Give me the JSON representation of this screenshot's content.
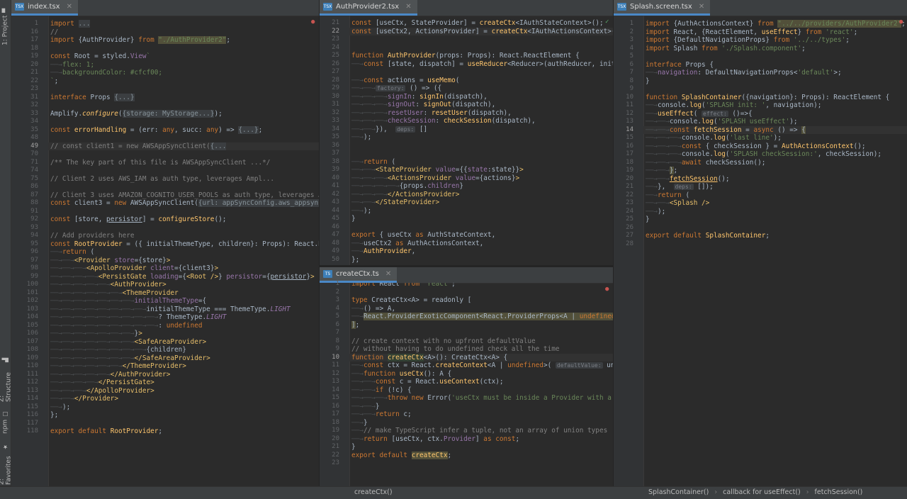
{
  "sidebar": {
    "project": "1: Project",
    "structure": "Z: Structure",
    "npm": "npm",
    "favorites": "2: Favorites"
  },
  "icons": {
    "file": "tsx-file-icon",
    "close": "close-icon",
    "fold": "fold-marker-icon",
    "error": "error-marker-icon",
    "ok": "check-icon"
  },
  "colors": {
    "keyword": "#cc7832",
    "string": "#6a8759",
    "function": "#ffc66d",
    "field": "#9876aa",
    "comment": "#808080",
    "tab_accent": "#4a88c7"
  },
  "editors": [
    {
      "tab": "index.tsx",
      "lines": [
        {
          "n": "1",
          "t": "<span class='kw'>import</span> <span class='col'>...</span>"
        },
        {
          "n": "16",
          "t": "<span class='cm'>//</span>"
        },
        {
          "n": "17",
          "t": "<span class='kw'>import</span> {AuthProvider} <span class='kw'>from</span> <span class='str hl2'>\"./AuthProvider2\"</span>;"
        },
        {
          "n": "18",
          "t": ""
        },
        {
          "n": "19",
          "t": "<span class='kw'>const</span> Root = styled.<span class='fld'>View</span><span class='str'>`</span>"
        },
        {
          "n": "20",
          "t": "<span class='tab-i'>──→</span><span class='str'>flex: 1;</span>"
        },
        {
          "n": "21",
          "t": "<span class='tab-i'>──→</span><span class='str'>backgroundColor: #cfcf00;</span>"
        },
        {
          "n": "22",
          "t": "<span class='str'>`</span>;"
        },
        {
          "n": "23",
          "t": ""
        },
        {
          "n": "31",
          "t": "<span class='kw'>interface</span> Props <span class='col'>{...}</span>"
        },
        {
          "n": "32",
          "t": ""
        },
        {
          "n": "33",
          "t": "Amplify.<span class='fn' style='font-style:italic'>configure</span>(<span class='col'>{storage: MyStorage...}</span>);"
        },
        {
          "n": "34",
          "t": ""
        },
        {
          "n": "35",
          "t": "<span class='kw'>const</span> <span class='fn'>errorHandling</span> = (err: <span class='kw'>any</span>, succ: <span class='kw'>any</span>) => <span class='col'>{...}</span>;"
        },
        {
          "n": "48",
          "t": ""
        },
        {
          "n": "49",
          "t": "<span class='cm'>// const client1 = new AWSAppSyncClient(</span><span class='col'>{...</span>",
          "cl": true
        },
        {
          "n": "70",
          "t": ""
        },
        {
          "n": "71",
          "t": "<span class='cm'>/** The key part of this file is AWSAppSyncClient ...*/</span>"
        },
        {
          "n": "74",
          "t": ""
        },
        {
          "n": "75",
          "t": "<span class='cm'>// Client 2 uses AWS_IAM as auth type, leverages Ampl...</span>"
        },
        {
          "n": "86",
          "t": ""
        },
        {
          "n": "87",
          "t": "<span class='cm'>// Client 3 uses AMAZON_COGNITO_USER_POOLS as auth type, leverages Ampli</span>"
        },
        {
          "n": "88",
          "t": "<span class='kw'>const</span> client3 = <span class='kw'>new</span> AWSAppSyncClient(<span class='col'>{url: appSyncConfig.aws_appsync_gra</span>"
        },
        {
          "n": "91",
          "t": ""
        },
        {
          "n": "92",
          "t": "<span class='kw'>const</span> [store, <span class='ul'>persistor</span>] = <span class='fn'>configureStore</span>();"
        },
        {
          "n": "93",
          "t": ""
        },
        {
          "n": "94",
          "t": "<span class='cm'>// Add providers here</span>"
        },
        {
          "n": "95",
          "t": "<span class='kw'>const</span> <span class='fn'>RootProvider</span> = ({ initialThemeType, children}: Props): React.React"
        },
        {
          "n": "96",
          "t": "<span class='tab-i'>──→</span><span class='kw'>return</span> ("
        },
        {
          "n": "97",
          "t": "<span class='tab-i'>──→──→</span><span class='tag'>&lt;Provider</span> <span class='fld'>store</span>={store}<span class='tag'>&gt;</span>"
        },
        {
          "n": "98",
          "t": "<span class='tab-i'>──→──→──→</span><span class='tag'>&lt;ApolloProvider</span> <span class='fld'>client</span>={client3}<span class='tag'>&gt;</span>"
        },
        {
          "n": "99",
          "t": "<span class='tab-i'>──→──→──→──→</span><span class='tag'>&lt;PersistGate</span> <span class='fld'>loading</span>={<span class='tag'>&lt;Root /&gt;</span>} <span class='fld'>persistor</span>={<span class='ul'>persistor</span>}<span class='tag'>&gt;</span>"
        },
        {
          "n": "100",
          "t": "<span class='tab-i'>──→──→──→──→──→</span><span class='tag'>&lt;AuthProvider&gt;</span>"
        },
        {
          "n": "101",
          "t": "<span class='tab-i'>──→──→──→──→──→──→</span><span class='tag'>&lt;ThemeProvider</span>"
        },
        {
          "n": "102",
          "t": "<span class='tab-i'>──→──→──→──→──→──→──→</span><span class='fld'>initialThemeType</span>={"
        },
        {
          "n": "103",
          "t": "<span class='tab-i'>──→──→──→──→──→──→──→──→</span>initialThemeType === ThemeType.<span class='it'>LIGHT</span>"
        },
        {
          "n": "104",
          "t": "<span class='tab-i'>──→──→──→──→──→──→──→──→──→</span>? ThemeType.<span class='it'>LIGHT</span>"
        },
        {
          "n": "105",
          "t": "<span class='tab-i'>──→──→──→──→──→──→──→──→──→</span>: <span class='kw'>undefined</span>"
        },
        {
          "n": "106",
          "t": "<span class='tab-i'>──→──→──→──→──→──→──→</span>}<span class='tag'>&gt;</span>"
        },
        {
          "n": "107",
          "t": "<span class='tab-i'>──→──→──→──→──→──→──→</span><span class='tag'>&lt;SafeAreaProvider&gt;</span>"
        },
        {
          "n": "108",
          "t": "<span class='tab-i'>──→──→──→──→──→──→──→──→</span>{children}"
        },
        {
          "n": "109",
          "t": "<span class='tab-i'>──→──→──→──→──→──→──→</span><span class='tag'>&lt;/SafeAreaProvider&gt;</span>"
        },
        {
          "n": "110",
          "t": "<span class='tab-i'>──→──→──→──→──→──→</span><span class='tag'>&lt;/ThemeProvider&gt;</span>"
        },
        {
          "n": "111",
          "t": "<span class='tab-i'>──→──→──→──→──→</span><span class='tag'>&lt;/AuthProvider&gt;</span>"
        },
        {
          "n": "112",
          "t": "<span class='tab-i'>──→──→──→──→</span><span class='tag'>&lt;/PersistGate&gt;</span>"
        },
        {
          "n": "113",
          "t": "<span class='tab-i'>──→──→──→</span><span class='tag'>&lt;/ApolloProvider&gt;</span>"
        },
        {
          "n": "114",
          "t": "<span class='tab-i'>──→──→</span><span class='tag'>&lt;/Provider&gt;</span>"
        },
        {
          "n": "115",
          "t": "<span class='tab-i'>──→</span>);"
        },
        {
          "n": "116",
          "t": "};"
        },
        {
          "n": "117",
          "t": ""
        },
        {
          "n": "118",
          "t": "<span class='kw'>export default</span> <span class='fn'>RootProvider</span>;"
        }
      ]
    },
    {
      "tab": "AuthProvider2.tsx",
      "lines": [
        {
          "n": "21",
          "t": "<span class='kw'>const</span> [useCtx, StateProvider] = <span class='fn'>createCtx</span>&lt;IAuthStateContext&gt;();"
        },
        {
          "n": "22",
          "t": "<span class='kw'>const</span> [useCtx2, ActionsProvider] = <span class='fn'>createCtx</span>&lt;IAuthActionsContext&gt;();",
          "cl": true
        },
        {
          "n": "23",
          "t": ""
        },
        {
          "n": "24",
          "t": ""
        },
        {
          "n": "25",
          "t": "<span class='kw'>function</span> <span class='fn'>AuthProvider</span>(props: Props): React.ReactElement {"
        },
        {
          "n": "26",
          "t": "<span class='tab-i'>──→</span><span class='kw'>const</span> [state, dispatch] = <span class='fn'>useReducer</span>&lt;Reducer&gt;(authReducer, initia"
        },
        {
          "n": "27",
          "t": ""
        },
        {
          "n": "28",
          "t": "<span class='tab-i'>──→</span><span class='kw'>const</span> actions = <span class='fn'>useMemo</span>("
        },
        {
          "n": "29",
          "t": "<span class='tab-i'>──→──→</span><span class='hint'>factory:</span> () => ({"
        },
        {
          "n": "30",
          "t": "<span class='tab-i'>──→──→──→</span><span class='fld'>signIn</span>: <span class='fn'>signIn</span>(dispatch),"
        },
        {
          "n": "31",
          "t": "<span class='tab-i'>──→──→──→</span><span class='fld'>signOut</span>: <span class='fn'>signOut</span>(dispatch),"
        },
        {
          "n": "32",
          "t": "<span class='tab-i'>──→──→──→</span><span class='fld'>resetUser</span>: <span class='fn'>resetUser</span>(dispatch),"
        },
        {
          "n": "33",
          "t": "<span class='tab-i'>──→──→──→</span><span class='fld'>checkSession</span>: <span class='fn'>checkSession</span>(dispatch),"
        },
        {
          "n": "34",
          "t": "<span class='tab-i'>──→──→</span>}),  <span class='hint'>deps:</span> []"
        },
        {
          "n": "35",
          "t": "<span class='tab-i'>──→</span>);"
        },
        {
          "n": "36",
          "t": ""
        },
        {
          "n": "37",
          "t": ""
        },
        {
          "n": "38",
          "t": "<span class='tab-i'>──→</span><span class='kw'>return</span> ("
        },
        {
          "n": "39",
          "t": "<span class='tab-i'>──→──→</span><span class='tag'>&lt;StateProvider</span> <span class='fld'>value</span>={{<span class='fld'>state</span>:state}}<span class='tag'>&gt;</span>"
        },
        {
          "n": "40",
          "t": "<span class='tab-i'>──→──→──→</span><span class='tag'>&lt;ActionsProvider</span> <span class='fld'>value</span>={actions}<span class='tag'>&gt;</span>"
        },
        {
          "n": "41",
          "t": "<span class='tab-i'>──→──→──→──→</span>{props.<span class='fld'>children</span>}"
        },
        {
          "n": "42",
          "t": "<span class='tab-i'>──→──→──→</span><span class='tag'>&lt;/ActionsProvider&gt;</span>"
        },
        {
          "n": "43",
          "t": "<span class='tab-i'>──→──→</span><span class='tag'>&lt;/StateProvider&gt;</span>"
        },
        {
          "n": "44",
          "t": "<span class='tab-i'>──→</span>);"
        },
        {
          "n": "45",
          "t": "}"
        },
        {
          "n": "46",
          "t": ""
        },
        {
          "n": "47",
          "t": "<span class='kw'>export</span> { useCtx <span class='kw'>as</span> AuthStateContext,"
        },
        {
          "n": "48",
          "t": "<span class='tab-i'>──→</span>useCtx2 <span class='kw'>as</span> AuthActionsContext,"
        },
        {
          "n": "49",
          "t": "<span class='tab-i'>──→</span><span class='fn'>AuthProvider</span>,"
        },
        {
          "n": "50",
          "t": "};"
        }
      ]
    },
    {
      "tab": "createCtx.ts",
      "lines": [
        {
          "n": "1",
          "t": "<span class='kw'>import</span> React <span class='kw'>from</span> <span class='str'>'react'</span>;"
        },
        {
          "n": "2",
          "t": ""
        },
        {
          "n": "3",
          "t": "<span class='kw'>type</span> CreateCtx&lt;A&gt; = readonly ["
        },
        {
          "n": "4",
          "t": "<span class='tab-i'>──→</span>() => A,"
        },
        {
          "n": "5",
          "t": "<span class='tab-i'>──→</span><span class='hl2'>React.ProviderExoticComponent&lt;React.ProviderProps&lt;A | <span class='kw'>undefined</span>&gt;&gt;</span>"
        },
        {
          "n": "6",
          "t": "<span class='hl2'>]</span>;"
        },
        {
          "n": "7",
          "t": ""
        },
        {
          "n": "8",
          "t": "<span class='cm'>// create context with no upfront defaultValue</span>"
        },
        {
          "n": "9",
          "t": "<span class='cm'>// without having to do undefined check all the time</span>"
        },
        {
          "n": "10",
          "t": "<span class='kw'>function</span> <span class='fn hl'>createCtx</span>&lt;A&gt;(): CreateCtx&lt;A&gt; {",
          "cl": true
        },
        {
          "n": "11",
          "t": "<span class='tab-i'>──→</span><span class='kw'>const</span> ctx = React.<span class='fn'>createContext</span>&lt;A | <span class='kw'>undefined</span>&gt;( <span class='hint'>defaultValue:</span> undefi"
        },
        {
          "n": "12",
          "t": "<span class='tab-i'>──→</span><span class='kw'>function</span> <span class='fn'>useCtx</span>(): A {"
        },
        {
          "n": "13",
          "t": "<span class='tab-i'>──→──→</span><span class='kw'>const</span> c = React.<span class='fn'>useContext</span>(ctx);"
        },
        {
          "n": "14",
          "t": "<span class='tab-i'>──→──→</span><span class='kw'>if</span> (!c) {"
        },
        {
          "n": "15",
          "t": "<span class='tab-i'>──→──→──→</span><span class='kw'>throw new</span> Error(<span class='str'>'useCtx must be inside a Provider with a</span>"
        },
        {
          "n": "16",
          "t": "<span class='tab-i'>──→──→</span>}"
        },
        {
          "n": "17",
          "t": "<span class='tab-i'>──→──→</span><span class='kw'>return</span> c;"
        },
        {
          "n": "18",
          "t": "<span class='tab-i'>──→</span>}"
        },
        {
          "n": "19",
          "t": "<span class='tab-i'>──→</span><span class='cm'>// make TypeScript infer a tuple, not an array of union types</span>"
        },
        {
          "n": "20",
          "t": "<span class='tab-i'>──→</span><span class='kw'>return</span> [useCtx, ctx.<span class='fld'>Provider</span>] <span class='kw'>as const</span>;"
        },
        {
          "n": "21",
          "t": "}"
        },
        {
          "n": "22",
          "t": "<span class='kw'>export default</span> <span class='fn hl2'>createCtx</span>;"
        },
        {
          "n": "23",
          "t": ""
        }
      ]
    },
    {
      "tab": "Splash.screen.tsx",
      "lines": [
        {
          "n": "1",
          "t": "<span class='kw'>import</span> {AuthActionsContext} <span class='kw'>from</span> <span class='str hl2'>\"../../providers/AuthProvider2\"</span>;"
        },
        {
          "n": "2",
          "t": "<span class='kw'>import</span> React, {ReactElement, <span class='fn'>useEffect</span>} <span class='kw'>from</span> <span class='str'>'react'</span>;"
        },
        {
          "n": "3",
          "t": "<span class='kw'>import</span> {DefaultNavigationProps} <span class='kw'>from</span> <span class='str'>'../../types'</span>;"
        },
        {
          "n": "4",
          "t": "<span class='kw'>import</span> Splash <span class='kw'>from</span> <span class='str'>'./Splash.component'</span>;"
        },
        {
          "n": "5",
          "t": ""
        },
        {
          "n": "6",
          "t": "<span class='kw'>interface</span> Props {"
        },
        {
          "n": "7",
          "t": "<span class='tab-i'>──→</span><span class='fld'>navigation</span>: DefaultNavigationProps&lt;<span class='str'>'default'</span>&gt;;"
        },
        {
          "n": "8",
          "t": "}"
        },
        {
          "n": "9",
          "t": ""
        },
        {
          "n": "10",
          "t": "<span class='kw'>function</span> <span class='fn'>SplashContainer</span>({navigation}: Props): ReactElement {"
        },
        {
          "n": "11",
          "t": "<span class='tab-i'>──→</span>console.<span class='fn'>log</span>(<span class='str'>'SPLASH init: '</span>, navigation);"
        },
        {
          "n": "12",
          "t": "<span class='tab-i'>──→</span><span class='fn'>useEffect</span>( <span class='hint'>effect:</span> ()=>{"
        },
        {
          "n": "13",
          "t": "<span class='tab-i'>──→──→</span>console.<span class='fn'>log</span>(<span class='str'>'SPLASH useEffect'</span>);"
        },
        {
          "n": "14",
          "t": "<span class='tab-i'>──→──→</span><span class='kw'>const</span> <span class='fn'>fetchSession</span> = <span class='kw'>async</span> () => <span class='hl2'>{</span>",
          "cl": true
        },
        {
          "n": "15",
          "t": "<span class='tab-i'>──→──→──→</span>console.<span class='fn'>log</span>(<span class='str'>'last line'</span>);"
        },
        {
          "n": "16",
          "t": "<span class='tab-i'>──→──→──→</span><span class='kw'>const</span> { checkSession } = <span class='fn'>AuthActionsContext</span>();"
        },
        {
          "n": "17",
          "t": "<span class='tab-i'>──→──→──→</span>console.<span class='fn'>log</span>(<span class='str'>'SPLASH checkSession:'</span>, checkSession);"
        },
        {
          "n": "18",
          "t": "<span class='tab-i'>──→──→──→</span><span class='kw'>await</span> checkSession();"
        },
        {
          "n": "19",
          "t": "<span class='tab-i'>──→──→</span><span class='hl2'>}</span>;"
        },
        {
          "n": "20",
          "t": "<span class='tab-i'>──→──→</span><span class='fn ul'>fetchSession</span>();"
        },
        {
          "n": "21",
          "t": "<span class='tab-i'>──→</span>},  <span class='hint'>deps:</span> []);"
        },
        {
          "n": "22",
          "t": "<span class='tab-i'>──→</span><span class='kw'>return</span> ("
        },
        {
          "n": "23",
          "t": "<span class='tab-i'>──→──→</span><span class='tag'>&lt;Splash /&gt;</span>"
        },
        {
          "n": "24",
          "t": "<span class='tab-i'>──→</span>);"
        },
        {
          "n": "25",
          "t": "}"
        },
        {
          "n": "26",
          "t": ""
        },
        {
          "n": "27",
          "t": "<span class='kw'>export default</span> <span class='fn'>SplashContainer</span>;"
        },
        {
          "n": "28",
          "t": ""
        }
      ]
    }
  ],
  "breadcrumbs": {
    "middle": "createCtx()",
    "right": [
      "SplashContainer()",
      "callback for useEffect()",
      "fetchSession()"
    ]
  }
}
